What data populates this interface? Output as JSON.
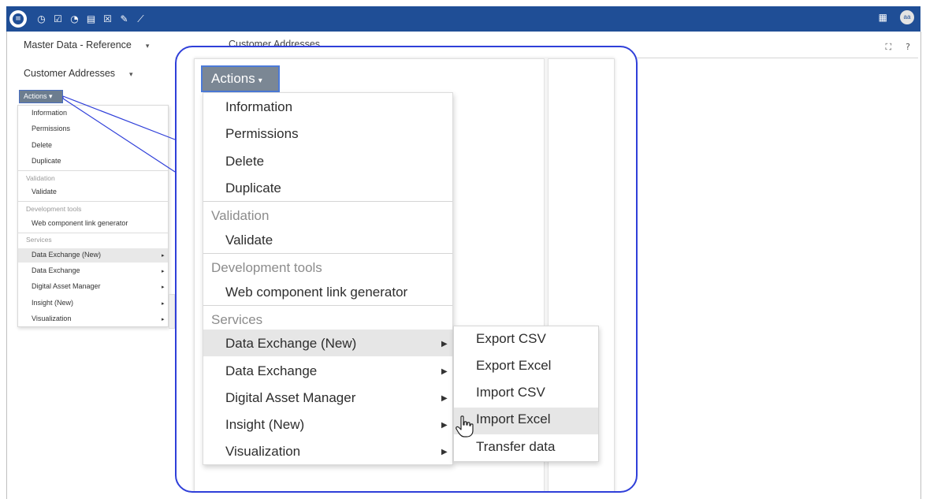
{
  "topbar": {
    "brand_bg": "#1f4e96",
    "icons": [
      "database-icon",
      "clock-icon",
      "checkbox-icon",
      "dashboard-icon",
      "data-model-icon",
      "task-icon",
      "pin-icon",
      "wrench-icon"
    ],
    "avatar": "aa"
  },
  "breadcrumb": {
    "dataspace": "Master Data - Reference",
    "table": "Customer Addresses"
  },
  "background_title": "Customer Addresses",
  "actions_label": "Actions",
  "menu": {
    "items_main": [
      "Information",
      "Permissions",
      "Delete",
      "Duplicate"
    ],
    "validation_header": "Validation",
    "validation_items": [
      "Validate"
    ],
    "devtools_header": "Development tools",
    "devtools_items": [
      "Web component link generator"
    ],
    "services_header": "Services",
    "services_items": [
      "Data Exchange (New)",
      "Data Exchange",
      "Digital Asset Manager",
      "Insight (New)",
      "Visualization"
    ]
  },
  "submenu": {
    "items": [
      "Export CSV",
      "Export Excel",
      "Import CSV",
      "Import Excel",
      "Transfer data"
    ],
    "hovered": "Import Excel"
  },
  "colors": {
    "callout_border": "#2f3fd9",
    "actions_button": "#7b8794",
    "highlight": "#e6e6e6"
  }
}
